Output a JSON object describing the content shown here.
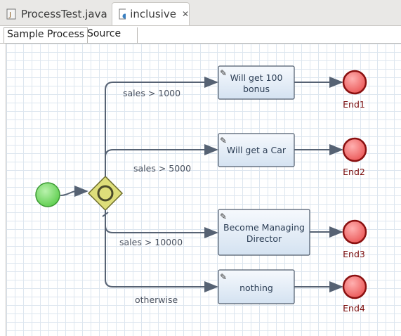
{
  "tabs": [
    {
      "label": "ProcessTest.java",
      "icon": "java-file-icon"
    },
    {
      "label": "inclusive",
      "icon": "process-file-icon",
      "close": "✕"
    }
  ],
  "subtabs": [
    {
      "label": "Sample Process"
    },
    {
      "label": "Source"
    }
  ],
  "diagram": {
    "tasks": [
      {
        "line1": "Will get 100",
        "line2": "bonus"
      },
      {
        "line1": "Will get a Car",
        "line2": ""
      },
      {
        "line1": "Become Managing",
        "line2": "Director"
      },
      {
        "line1": "nothing",
        "line2": ""
      }
    ],
    "conditions": [
      "sales > 1000",
      "sales > 5000",
      "sales > 10000",
      "otherwise"
    ],
    "ends": [
      "End1",
      "End2",
      "End3",
      "End4"
    ],
    "colors": {
      "start": "#7ddc6e",
      "gateway": "#dede7a",
      "end": "#f06a6a",
      "task": "#dce8f5",
      "edge": "#566273"
    }
  }
}
